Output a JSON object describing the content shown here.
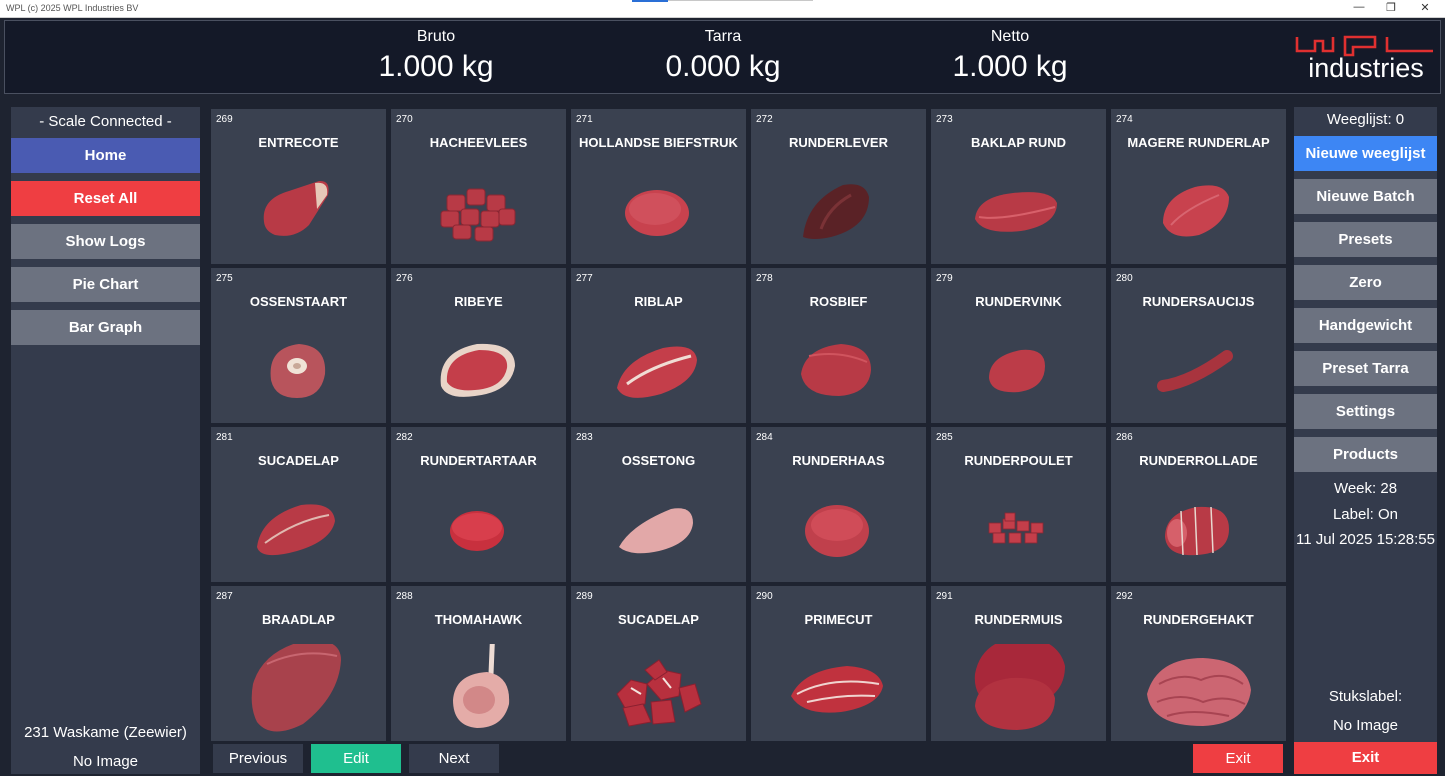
{
  "window": {
    "title": "WPL (c) 2025 WPL Industries BV"
  },
  "header": {
    "bruto": {
      "label": "Bruto",
      "value": "1.000 kg"
    },
    "tarra": {
      "label": "Tarra",
      "value": "0.000 kg"
    },
    "netto": {
      "label": "Netto",
      "value": "1.000 kg"
    }
  },
  "logo": {
    "text": "industries",
    "color": "#e03030"
  },
  "sidebar": {
    "status": "- Scale Connected -",
    "buttons": [
      {
        "label": "Home",
        "color": "#4a5bb2"
      },
      {
        "label": "Reset All",
        "color": "#ef3e42"
      },
      {
        "label": "Show Logs",
        "color": "#6c7280"
      },
      {
        "label": "Pie Chart",
        "color": "#6c7280"
      },
      {
        "label": "Bar Graph",
        "color": "#6c7280"
      }
    ],
    "product": "231 Waskame (Zeewier)",
    "image": "No Image"
  },
  "products": [
    {
      "num": "269",
      "name": "ENTRECOTE"
    },
    {
      "num": "270",
      "name": "HACHEEVLEES"
    },
    {
      "num": "271",
      "name": "HOLLANDSE BIEFSTRUK"
    },
    {
      "num": "272",
      "name": "RUNDERLEVER"
    },
    {
      "num": "273",
      "name": "BAKLAP RUND"
    },
    {
      "num": "274",
      "name": "MAGERE RUNDERLAP"
    },
    {
      "num": "275",
      "name": "OSSENSTAART"
    },
    {
      "num": "276",
      "name": "RIBEYE"
    },
    {
      "num": "277",
      "name": "RIBLAP"
    },
    {
      "num": "278",
      "name": "ROSBIEF"
    },
    {
      "num": "279",
      "name": "RUNDERVINK"
    },
    {
      "num": "280",
      "name": "RUNDERSAUCIJS"
    },
    {
      "num": "281",
      "name": "SUCADELAP"
    },
    {
      "num": "282",
      "name": "RUNDERTARTAAR"
    },
    {
      "num": "283",
      "name": "OSSETONG"
    },
    {
      "num": "284",
      "name": "RUNDERHAAS"
    },
    {
      "num": "285",
      "name": "RUNDERPOULET"
    },
    {
      "num": "286",
      "name": "RUNDERROLLADE"
    },
    {
      "num": "287",
      "name": "BRAADLAP"
    },
    {
      "num": "288",
      "name": "THOMAHAWK"
    },
    {
      "num": "289",
      "name": "SUCADELAP"
    },
    {
      "num": "290",
      "name": "PRIMECUT"
    },
    {
      "num": "291",
      "name": "RUNDERMUIS"
    },
    {
      "num": "292",
      "name": "RUNDERGEHAKT"
    }
  ],
  "pager": {
    "previous": "Previous",
    "edit": "Edit",
    "next": "Next",
    "exit": "Exit"
  },
  "right": {
    "weeglijst": "Weeglijst: 0",
    "buttons": [
      {
        "label": "Nieuwe weeglijst",
        "color": "#3d86f4"
      },
      {
        "label": "Nieuwe Batch",
        "color": "#6c7280"
      },
      {
        "label": "Presets",
        "color": "#6c7280"
      },
      {
        "label": "Zero",
        "color": "#6c7280"
      },
      {
        "label": "Handgewicht",
        "color": "#6c7280"
      },
      {
        "label": "Preset Tarra",
        "color": "#6c7280"
      },
      {
        "label": "Settings",
        "color": "#6c7280"
      },
      {
        "label": "Products",
        "color": "#6c7280"
      }
    ],
    "week": "Week: 28",
    "label": "Label: On",
    "datetime": "11 Jul 2025 15:28:55",
    "stukslabel": "Stukslabel:",
    "image": "No Image",
    "exit": "Exit"
  },
  "colors": {
    "exit": "#ef3e42",
    "edit": "#1fbf8f",
    "tile": "#3a4150",
    "meat": "#b83a46"
  }
}
